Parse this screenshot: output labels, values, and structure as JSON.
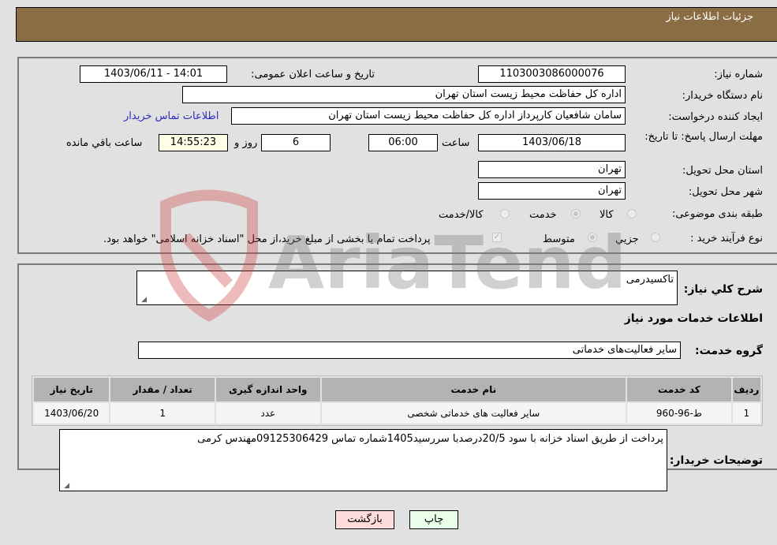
{
  "header": {
    "title": "جزئیات اطلاعات نیاز"
  },
  "form": {
    "need_number": {
      "label": "شماره نیاز:",
      "value": "1103003086000076"
    },
    "announce_datetime": {
      "label": "تاریخ و ساعت اعلان عمومی:",
      "value": "1403/06/11 - 14:01"
    },
    "buyer_org": {
      "label": "نام دستگاه خریدار:",
      "value": "اداره کل حفاظت محیط زیست استان تهران"
    },
    "requester": {
      "label": "ایجاد کننده درخواست:",
      "value": "سامان شافعیان کارپرداز اداره کل حفاظت محیط زیست استان تهران"
    },
    "buyer_contact_link": "اطلاعات تماس خریدار",
    "deadline": {
      "label": "مهلت ارسال پاسخ: تا تاریخ:",
      "date": "1403/06/18",
      "time_label": "ساعت",
      "time": "06:00",
      "days": "6",
      "days_label": "روز و",
      "remaining": "14:55:23",
      "remaining_label": "ساعت باقي مانده"
    },
    "delivery_province": {
      "label": "استان محل تحویل:",
      "value": "تهران"
    },
    "delivery_city": {
      "label": "شهر محل تحویل:",
      "value": "تهران"
    },
    "category": {
      "label": "طبقه بندی موضوعی:",
      "options": [
        "کالا",
        "خدمت",
        "کالا/خدمت"
      ],
      "selected": "خدمت"
    },
    "purchase_process": {
      "label": "نوع فرآیند خرید :",
      "options": [
        "جزیي",
        "متوسط"
      ],
      "selected": "متوسط",
      "treasury_note": "پرداخت تمام یا بخشی از مبلغ خرید،از محل \"اسناد خزانه اسلامی\" خواهد بود.",
      "treasury_checked": true
    }
  },
  "details": {
    "general_desc_label": "شرح کلي نياز:",
    "general_desc_value": "تاکسیدرمی",
    "services_heading": "اطلاعات خدمات مورد نياز",
    "service_group_label": "گروه خدمت:",
    "service_group_value": "سایر فعالیت‌های خدماتی",
    "table": {
      "headers": [
        "ردیف",
        "کد خدمت",
        "نام خدمت",
        "واحد اندازه گیری",
        "تعداد / مقدار",
        "تاریخ نیاز"
      ],
      "rows": [
        [
          "1",
          "ط-96-960",
          "سایر فعالیت های خدماتی شخصی",
          "عدد",
          "1",
          "1403/06/20"
        ]
      ]
    },
    "buyer_notes_label": "توضیحات خریدار:",
    "buyer_notes_value": "پرداخت از طریق اسناد خزانه با سود 20/5درصدبا سررسید1405شماره تماس 09125306429مهندس کرمی"
  },
  "buttons": {
    "print": "چاپ",
    "back": "بازگشت"
  },
  "colors": {
    "header_bg": "#8b6d43",
    "print_bg": "#eaffea",
    "back_bg": "#ffdcdc",
    "link": "#2a2ac0"
  },
  "watermark": "AriaTender.neT"
}
